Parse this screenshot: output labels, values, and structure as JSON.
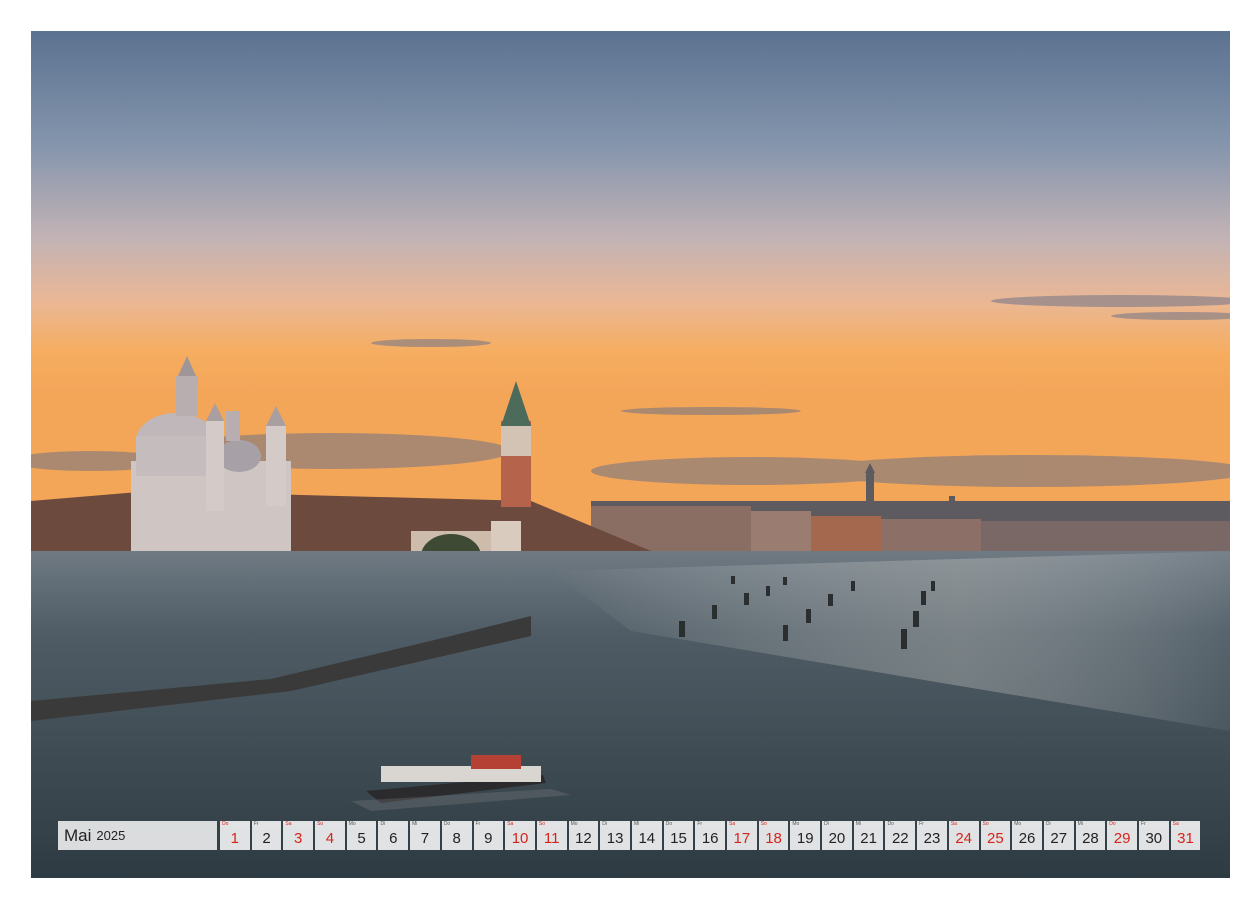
{
  "calendar": {
    "month": "Mai",
    "year": "2025",
    "days": [
      {
        "n": "1",
        "wd": "Do",
        "red": true
      },
      {
        "n": "2",
        "wd": "Fr",
        "red": false
      },
      {
        "n": "3",
        "wd": "Sa",
        "red": true
      },
      {
        "n": "4",
        "wd": "So",
        "red": true
      },
      {
        "n": "5",
        "wd": "Mo",
        "red": false
      },
      {
        "n": "6",
        "wd": "Di",
        "red": false
      },
      {
        "n": "7",
        "wd": "Mi",
        "red": false
      },
      {
        "n": "8",
        "wd": "Do",
        "red": false
      },
      {
        "n": "9",
        "wd": "Fr",
        "red": false
      },
      {
        "n": "10",
        "wd": "Sa",
        "red": true
      },
      {
        "n": "11",
        "wd": "So",
        "red": true
      },
      {
        "n": "12",
        "wd": "Mo",
        "red": false
      },
      {
        "n": "13",
        "wd": "Di",
        "red": false
      },
      {
        "n": "14",
        "wd": "Mi",
        "red": false
      },
      {
        "n": "15",
        "wd": "Do",
        "red": false
      },
      {
        "n": "16",
        "wd": "Fr",
        "red": false
      },
      {
        "n": "17",
        "wd": "Sa",
        "red": true
      },
      {
        "n": "18",
        "wd": "So",
        "red": true
      },
      {
        "n": "19",
        "wd": "Mo",
        "red": false
      },
      {
        "n": "20",
        "wd": "Di",
        "red": false
      },
      {
        "n": "21",
        "wd": "Mi",
        "red": false
      },
      {
        "n": "22",
        "wd": "Do",
        "red": false
      },
      {
        "n": "23",
        "wd": "Fr",
        "red": false
      },
      {
        "n": "24",
        "wd": "Sa",
        "red": true
      },
      {
        "n": "25",
        "wd": "So",
        "red": true
      },
      {
        "n": "26",
        "wd": "Mo",
        "red": false
      },
      {
        "n": "27",
        "wd": "Di",
        "red": false
      },
      {
        "n": "28",
        "wd": "Mi",
        "red": false
      },
      {
        "n": "29",
        "wd": "Do",
        "red": true
      },
      {
        "n": "30",
        "wd": "Fr",
        "red": false
      },
      {
        "n": "31",
        "wd": "Sa",
        "red": true
      }
    ]
  },
  "colors": {
    "holiday": "#d6231c",
    "sky_top": "#5f7694",
    "sky_mid": "#c9b3b0",
    "sky_glow": "#f4b067",
    "water": "#3c4a52"
  }
}
